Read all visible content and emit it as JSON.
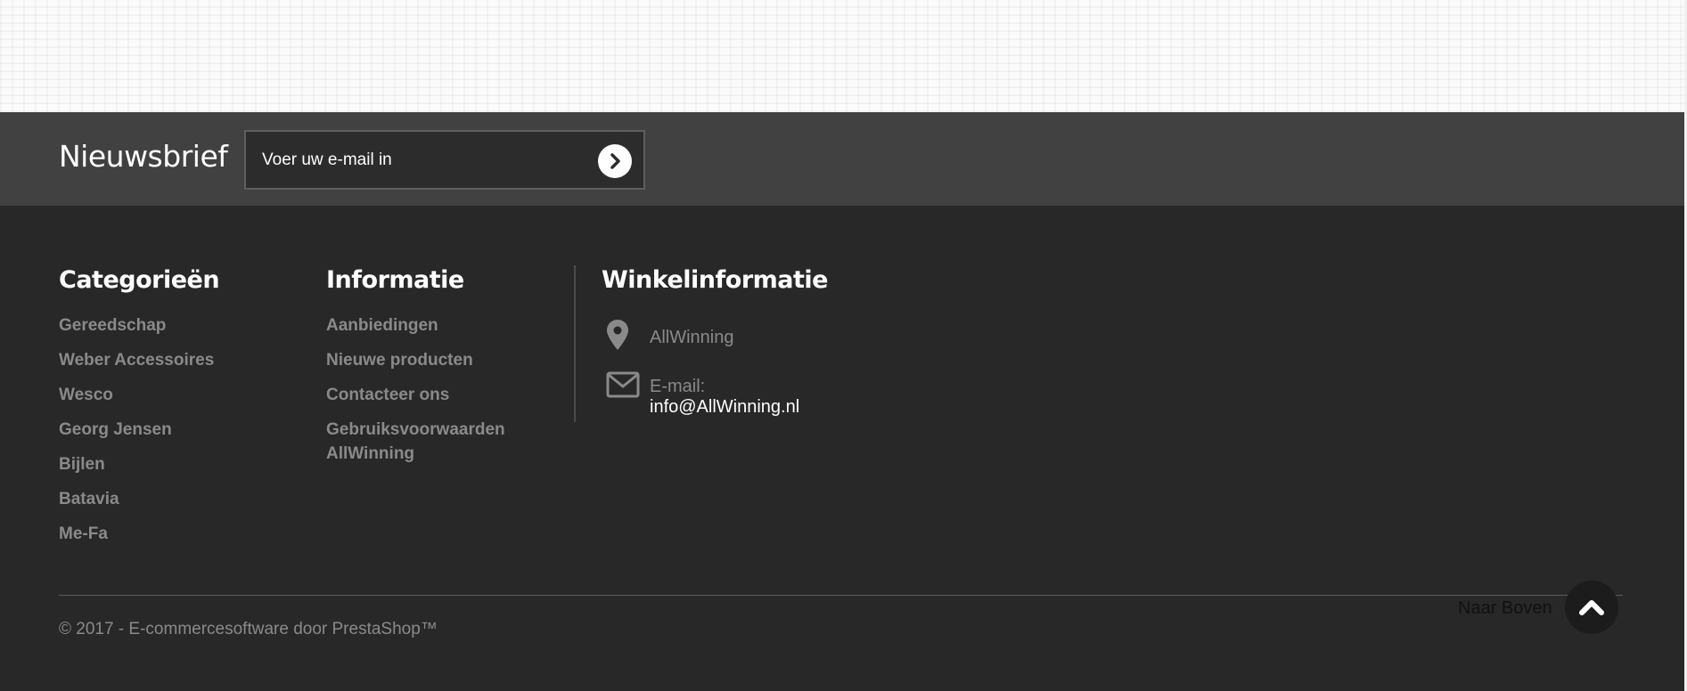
{
  "newsletter": {
    "title": "Nieuwsbrief",
    "email_placeholder": "Voer uw e-mail in"
  },
  "categories": {
    "title": "Categorieën",
    "items": [
      "Gereedschap",
      "Weber Accessoires",
      "Wesco",
      "Georg Jensen",
      "Bijlen",
      "Batavia",
      "Me-Fa"
    ]
  },
  "information": {
    "title": "Informatie",
    "items": [
      "Aanbiedingen",
      "Nieuwe producten",
      "Contacteer ons",
      "Gebruiksvoorwaarden AllWinning"
    ]
  },
  "store_info": {
    "title": "Winkelinformatie",
    "name": "AllWinning",
    "email_label": "E-mail:",
    "email": "info@AllWinning.nl"
  },
  "footer": {
    "copyright": "© 2017 - E-commercesoftware door PrestaShop™",
    "back_to_top": "Naar Boven"
  },
  "colors": {
    "newsletter_bg": "#414141",
    "footer_bg": "#282828",
    "link_gray": "#8a8a8a",
    "heading_white": "#ffffff"
  }
}
